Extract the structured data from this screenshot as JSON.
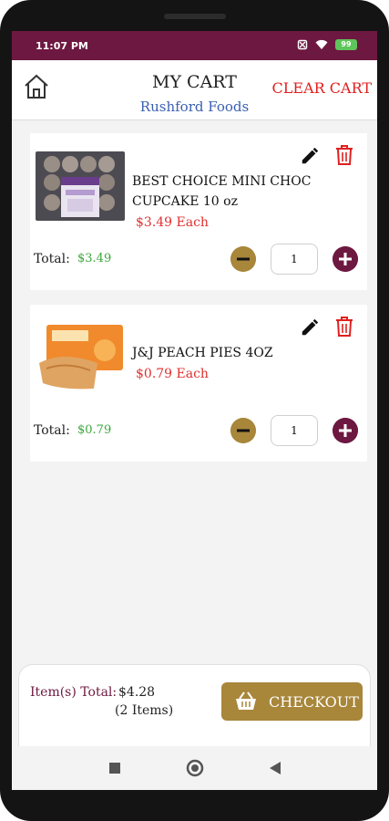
{
  "status_bar": {
    "time": "11:07 PM",
    "battery": "99"
  },
  "header": {
    "title": "MY CART",
    "store": "Rushford Foods",
    "clear_cart": "CLEAR CART"
  },
  "cart_items": [
    {
      "name": "BEST CHOICE MINI CHOC CUPCAKE 10 oz",
      "price": "$3.49 Each",
      "total_label": "Total:",
      "total": "$3.49",
      "quantity": "1"
    },
    {
      "name": "J&J  PEACH PIES 4OZ",
      "price": "$0.79 Each",
      "total_label": "Total:",
      "total": "$0.79",
      "quantity": "1"
    }
  ],
  "footer": {
    "items_total_label": "Item(s) Total:",
    "items_total_value": "$4.28",
    "items_count": "(2 Items)",
    "checkout_label": "CHECKOUT"
  },
  "colors": {
    "brand": "#6d1840",
    "accent": "#a8863a",
    "price": "#e03030",
    "total": "#3aa83a",
    "link": "#3a5fb0"
  }
}
